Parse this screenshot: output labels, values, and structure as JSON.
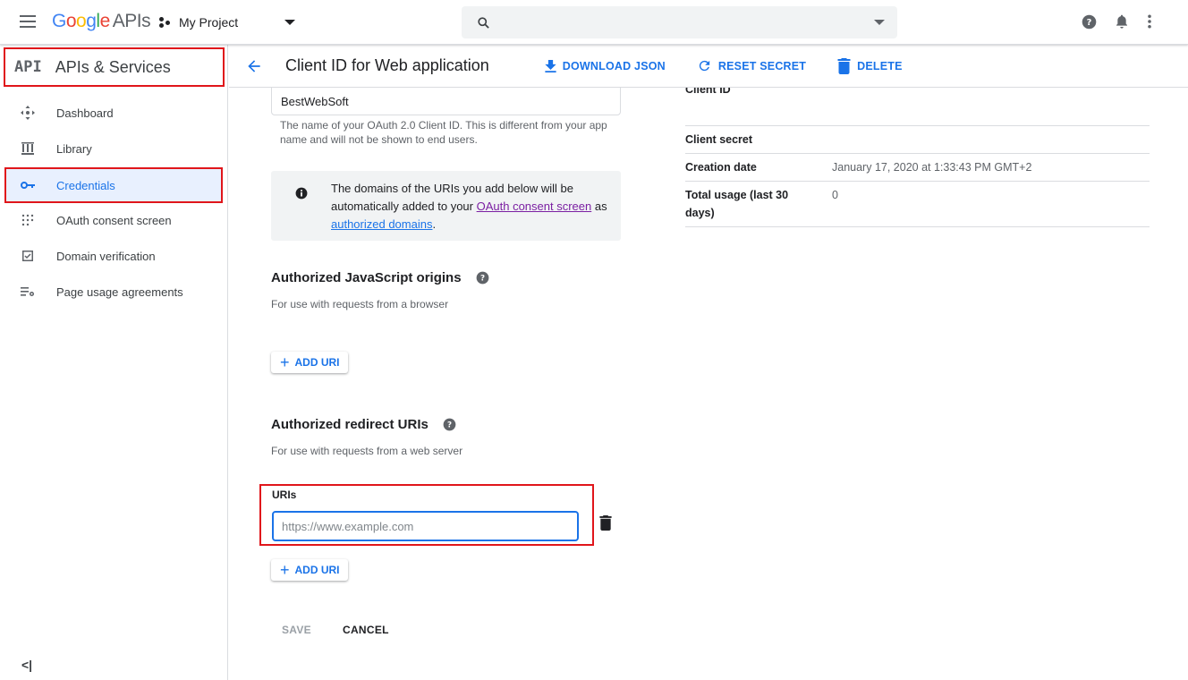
{
  "topbar": {
    "logo_google": [
      "G",
      "o",
      "o",
      "g",
      "l",
      "e"
    ],
    "logo_apis": "APIs",
    "project_name": "My Project",
    "search_placeholder": ""
  },
  "sidebar": {
    "api_badge": "API",
    "title": "APIs & Services",
    "items": [
      {
        "label": "Dashboard",
        "icon": "dashboard-icon"
      },
      {
        "label": "Library",
        "icon": "library-icon"
      },
      {
        "label": "Credentials",
        "icon": "key-icon",
        "active": true
      },
      {
        "label": "OAuth consent screen",
        "icon": "consent-icon"
      },
      {
        "label": "Domain verification",
        "icon": "checkbox-icon"
      },
      {
        "label": "Page usage agreements",
        "icon": "settings-list-icon"
      }
    ],
    "collapse_label": "<|"
  },
  "header": {
    "title": "Client ID for Web application",
    "download_json": "DOWNLOAD JSON",
    "reset_secret": "RESET SECRET",
    "delete": "DELETE"
  },
  "form": {
    "name_value": "BestWebSoft",
    "name_hint": "The name of your OAuth 2.0 Client ID. This is different from your app name and will not be shown to end users.",
    "info": {
      "text1": "The domains of the URIs you add below will be automatically added to your ",
      "link1": "OAuth consent screen",
      "text2": " as ",
      "link2": "authorized domains",
      "text3": "."
    },
    "js_origins": {
      "title": "Authorized JavaScript origins",
      "subtitle": "For use with requests from a browser",
      "add_label": "ADD URI"
    },
    "redirect_uris": {
      "title": "Authorized redirect URIs",
      "subtitle": "For use with requests from a web server",
      "uris_label": "URIs",
      "uri_placeholder": "https://www.example.com",
      "add_label": "ADD URI"
    },
    "save_label": "SAVE",
    "cancel_label": "CANCEL"
  },
  "details": {
    "rows": [
      {
        "key": "Client ID",
        "value": ""
      },
      {
        "key": "Client secret",
        "value": ""
      },
      {
        "key": "Creation date",
        "value": "January 17, 2020 at 1:33:43 PM GMT+2"
      },
      {
        "key": "Total usage (last 30 days)",
        "value": "0"
      }
    ]
  },
  "colors": {
    "accent": "#1a73e8",
    "highlight_red": "#e0161b",
    "active_bg": "#e8f0fe"
  }
}
